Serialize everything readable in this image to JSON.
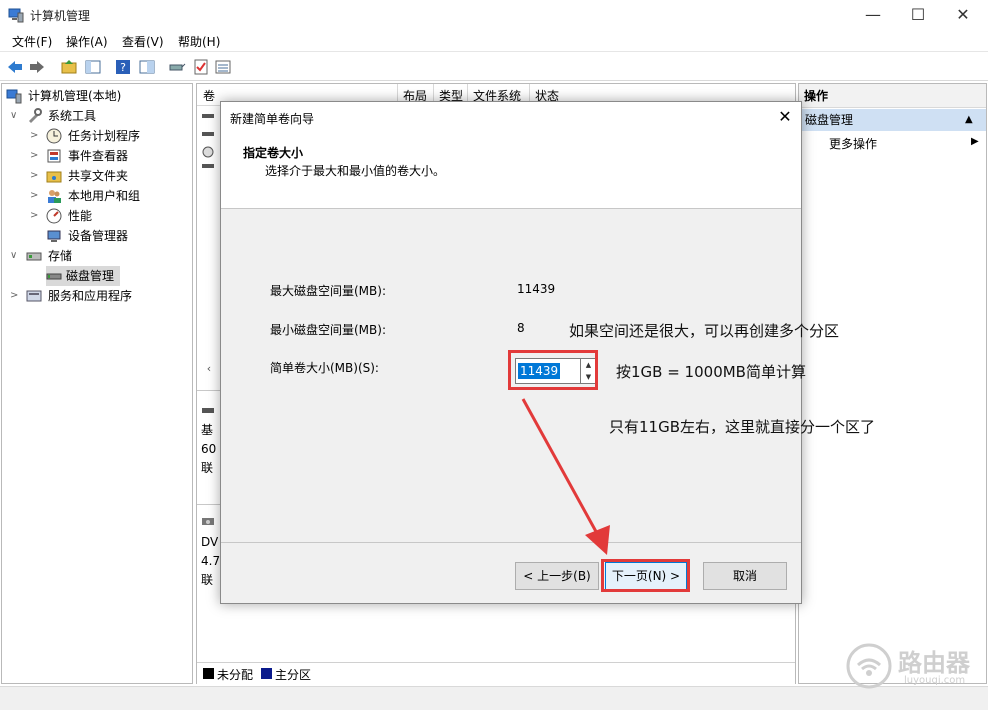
{
  "window": {
    "title": "计算机管理",
    "minimize": "—",
    "maximize": "☐",
    "close": "✕"
  },
  "menu": [
    "文件(F)",
    "操作(A)",
    "查看(V)",
    "帮助(H)"
  ],
  "tree": [
    {
      "label": "计算机管理(本地)",
      "indent": 0,
      "arrow": "",
      "icon": "computer-management-icon"
    },
    {
      "label": "系统工具",
      "indent": 1,
      "arrow": "∨",
      "icon": "tools-icon"
    },
    {
      "label": "任务计划程序",
      "indent": 2,
      "arrow": ">",
      "icon": "clock-icon"
    },
    {
      "label": "事件查看器",
      "indent": 2,
      "arrow": ">",
      "icon": "event-viewer-icon"
    },
    {
      "label": "共享文件夹",
      "indent": 2,
      "arrow": ">",
      "icon": "shared-folder-icon"
    },
    {
      "label": "本地用户和组",
      "indent": 2,
      "arrow": ">",
      "icon": "users-icon"
    },
    {
      "label": "性能",
      "indent": 2,
      "arrow": ">",
      "icon": "performance-icon"
    },
    {
      "label": "设备管理器",
      "indent": 2,
      "arrow": "",
      "icon": "device-manager-icon"
    },
    {
      "label": "存储",
      "indent": 1,
      "arrow": "∨",
      "icon": "storage-icon"
    },
    {
      "label": "磁盘管理",
      "indent": 2,
      "arrow": "",
      "icon": "disk-management-icon",
      "selected": true
    },
    {
      "label": "服务和应用程序",
      "indent": 0,
      "arrow": ">",
      "icon": "services-icon"
    }
  ],
  "center": {
    "columns": [
      "卷",
      "布局",
      "类型",
      "文件系统",
      "状态"
    ],
    "disk_rows": [
      {
        "line1": "基",
        "line2": "60",
        "line3": "联"
      },
      {
        "line1": "DV",
        "line2": "4.7",
        "line3": "联"
      }
    ],
    "legend": [
      {
        "label": "未分配",
        "color": "#000000"
      },
      {
        "label": "主分区",
        "color": "#0a1a8c"
      }
    ]
  },
  "actions": {
    "header": "操作",
    "section": "磁盘管理",
    "more": "更多操作"
  },
  "dialog": {
    "title": "新建简单卷向导",
    "close": "✕",
    "heading": "指定卷大小",
    "subheading": "选择介于最大和最小值的卷大小。",
    "max_label": "最大磁盘空间量(MB):",
    "max_value": "11439",
    "min_label": "最小磁盘空间量(MB):",
    "min_value": "8",
    "size_label": "简单卷大小(MB)(S):",
    "size_value": "11439",
    "btn_back": "< 上一步(B)",
    "btn_next": "下一页(N) >",
    "btn_cancel": "取消"
  },
  "annotations": {
    "note1": "如果空间还是很大，可以再创建多个分区",
    "note2": "按1GB = 1000MB简单计算",
    "note3": "只有11GB左右，这里就直接分一个区了",
    "color": "#e23a3a"
  },
  "watermark": {
    "title": "路由器",
    "subtitle": "luyouqi.com"
  }
}
